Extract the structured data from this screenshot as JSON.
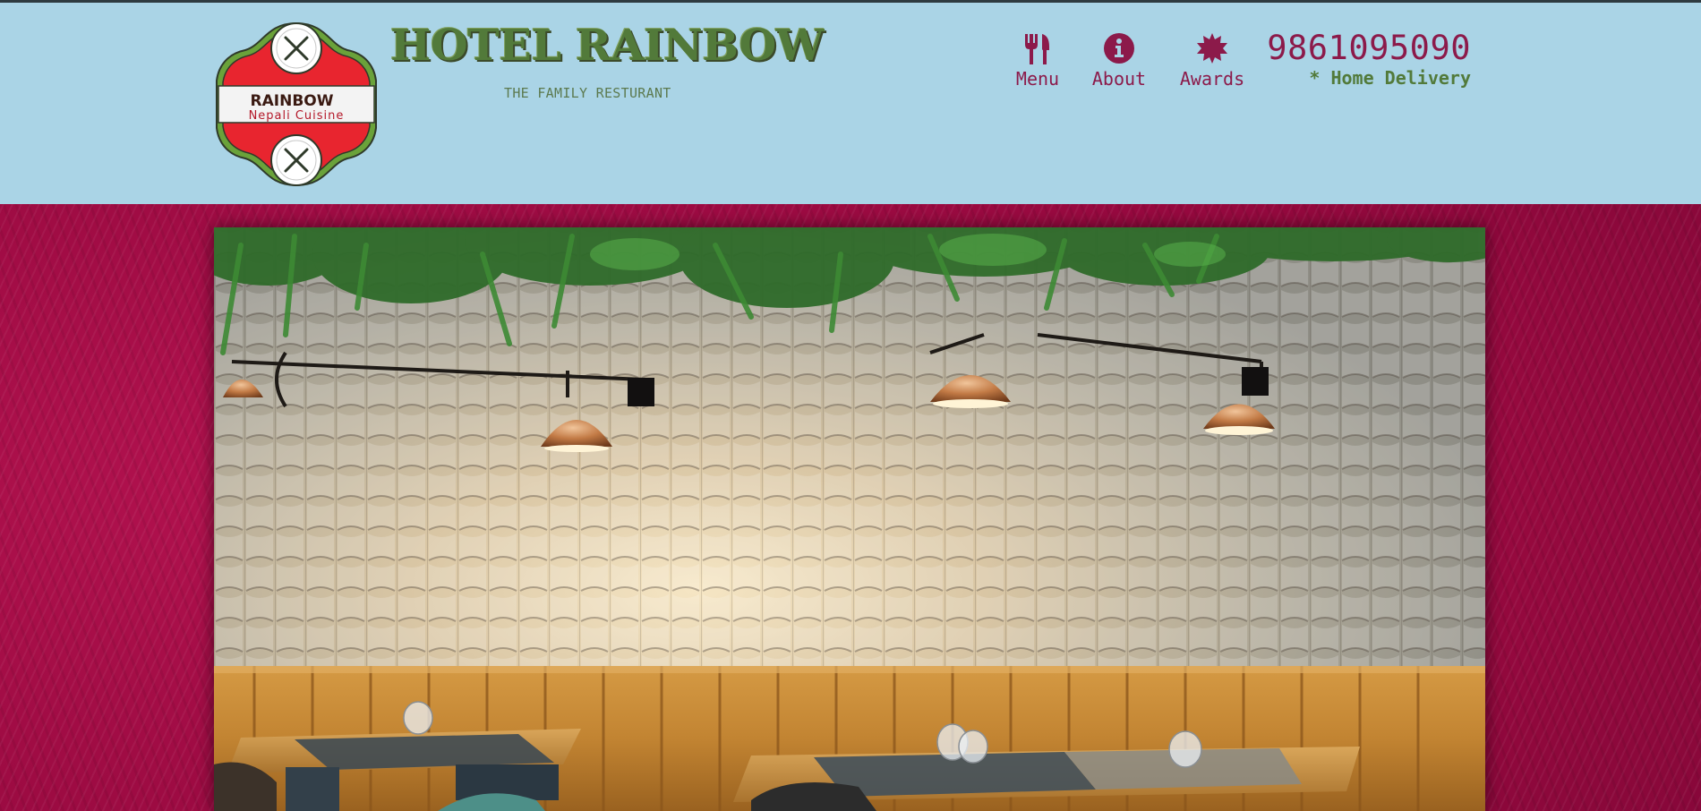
{
  "header": {
    "title": "HOTEL RAINBOW",
    "tagline": "THE FAMILY RESTURANT",
    "logo": {
      "name": "RAINBOW",
      "subtitle": "Nepali Cuisine"
    },
    "nav": [
      {
        "label": "Menu",
        "icon": "utensils-icon"
      },
      {
        "label": "About",
        "icon": "info-circle-icon"
      },
      {
        "label": "Awards",
        "icon": "award-burst-icon"
      }
    ],
    "phone": "9861095090",
    "delivery": "* Home Delivery"
  },
  "hero": {
    "image_subject": "restaurant interior"
  },
  "colors": {
    "header_bg": "#aad4e6",
    "accent": "#8c1a4a",
    "title_green": "#527a3a",
    "page_bg": "#9e0d45"
  }
}
